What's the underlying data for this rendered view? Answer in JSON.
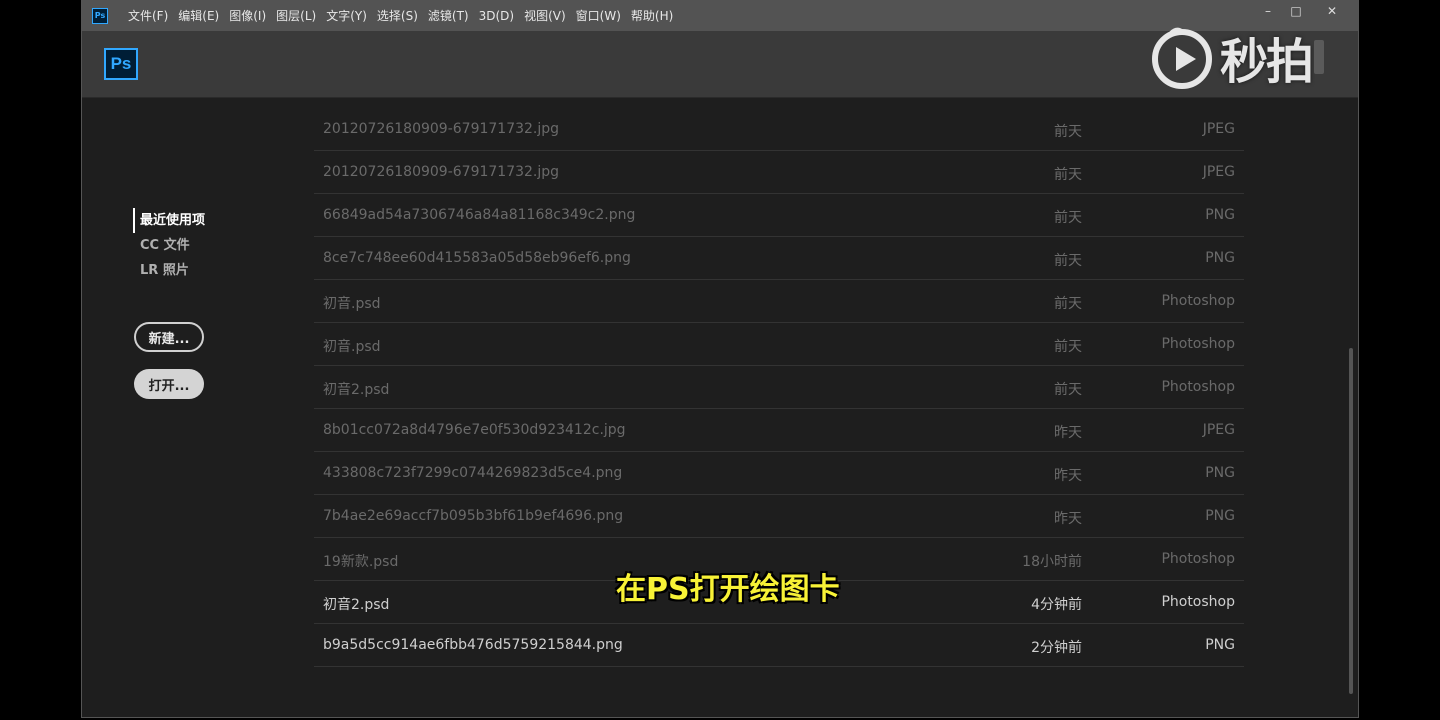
{
  "menubar": {
    "app_icon_text": "Ps",
    "items": [
      "文件(F)",
      "编辑(E)",
      "图像(I)",
      "图层(L)",
      "文字(Y)",
      "选择(S)",
      "滤镜(T)",
      "3D(D)",
      "视图(V)",
      "窗口(W)",
      "帮助(H)"
    ],
    "window_controls": {
      "minimize": "–",
      "maximize": "□",
      "close": "✕"
    }
  },
  "header": {
    "logo_text": "Ps"
  },
  "sidebar": {
    "items": [
      "最近使用项",
      "CC 文件",
      "LR 照片"
    ],
    "active": "最近使用项"
  },
  "buttons": {
    "new": "新建...",
    "open": "打开..."
  },
  "files": [
    {
      "name": "20120726180909-679171732.jpg",
      "time": "前天",
      "type": "JPEG"
    },
    {
      "name": "20120726180909-679171732.jpg",
      "time": "前天",
      "type": "JPEG"
    },
    {
      "name": "66849ad54a7306746a84a81168c349c2.png",
      "time": "前天",
      "type": "PNG"
    },
    {
      "name": "8ce7c748ee60d415583a05d58eb96ef6.png",
      "time": "前天",
      "type": "PNG"
    },
    {
      "name": "初音.psd",
      "time": "前天",
      "type": "Photoshop"
    },
    {
      "name": "初音.psd",
      "time": "前天",
      "type": "Photoshop"
    },
    {
      "name": "初音2.psd",
      "time": "前天",
      "type": "Photoshop"
    },
    {
      "name": "8b01cc072a8d4796e7e0f530d923412c.jpg",
      "time": "昨天",
      "type": "JPEG"
    },
    {
      "name": "433808c723f7299c0744269823d5ce4.png",
      "time": "昨天",
      "type": "PNG"
    },
    {
      "name": "7b4ae2e69accf7b095b3bf61b9ef4696.png",
      "time": "昨天",
      "type": "PNG"
    },
    {
      "name": "19新款.psd",
      "time": "18小时前",
      "type": "Photoshop"
    },
    {
      "name": "初音2.psd",
      "time": "4分钟前",
      "type": "Photoshop"
    },
    {
      "name": "b9a5d5cc914ae6fbb476d5759215844.png",
      "time": "2分钟前",
      "type": "PNG"
    }
  ],
  "subtitle": "在PS打开绘图卡",
  "watermark": {
    "text": "秒拍",
    "icon": "play-icon"
  },
  "colors": {
    "accent": "#31a8ff",
    "subtitle": "#f8f236",
    "background": "#1e1e1e"
  }
}
